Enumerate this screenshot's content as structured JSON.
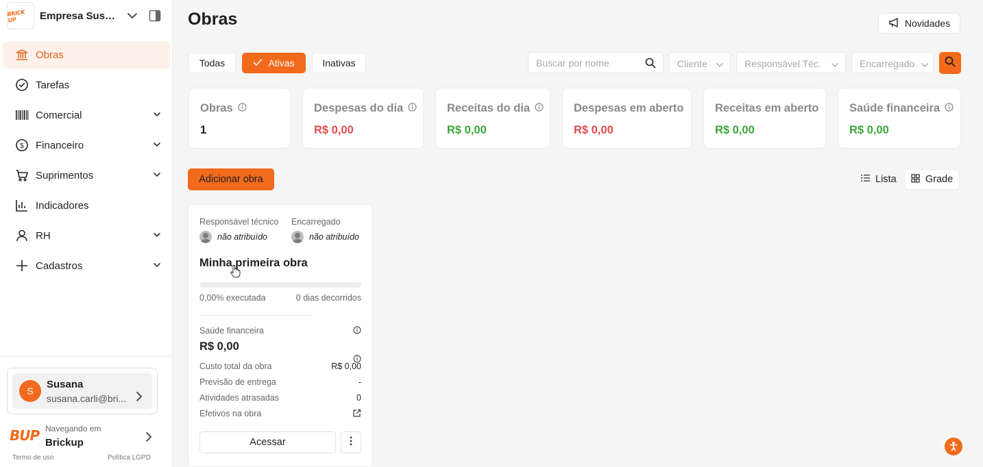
{
  "company": {
    "name": "Empresa Susan...",
    "logo_text": "BRICK UP"
  },
  "sidebar": {
    "items": [
      {
        "label": "Obras",
        "icon": "bank-icon",
        "active": true,
        "expandable": false
      },
      {
        "label": "Tarefas",
        "icon": "check-circle-icon",
        "active": false,
        "expandable": false
      },
      {
        "label": "Comercial",
        "icon": "barcode-icon",
        "active": false,
        "expandable": true
      },
      {
        "label": "Financeiro",
        "icon": "dollar-circle-icon",
        "active": false,
        "expandable": true
      },
      {
        "label": "Suprimentos",
        "icon": "cart-icon",
        "active": false,
        "expandable": true
      },
      {
        "label": "Indicadores",
        "icon": "bar-chart-icon",
        "active": false,
        "expandable": false
      },
      {
        "label": "RH",
        "icon": "user-icon",
        "active": false,
        "expandable": true
      },
      {
        "label": "Cadastros",
        "icon": "plus-icon",
        "active": false,
        "expandable": true
      }
    ]
  },
  "user": {
    "initial": "S",
    "name": "Susana",
    "email": "susana.carli@bri..."
  },
  "brand": {
    "navigating_label": "Navegando em",
    "name": "Brickup",
    "logo_text": "BUP"
  },
  "footer": {
    "terms": "Termo de uso",
    "privacy": "Política LGPD"
  },
  "header": {
    "title": "Obras",
    "news_label": "Novidades"
  },
  "filters": {
    "tabs": [
      {
        "label": "Todas",
        "active": false
      },
      {
        "label": "Ativas",
        "active": true
      },
      {
        "label": "Inativas",
        "active": false
      }
    ],
    "search_placeholder": "Buscar por nome",
    "client_placeholder": "Cliente",
    "responsible_placeholder": "Responsável Téc.",
    "foreman_placeholder": "Encarregado"
  },
  "stats": [
    {
      "label": "Obras",
      "value": "1",
      "info": true,
      "tone": "dark"
    },
    {
      "label": "Despesas do dia",
      "value": "R$ 0,00",
      "info": true,
      "tone": "red"
    },
    {
      "label": "Receitas do dia",
      "value": "R$ 0,00",
      "info": true,
      "tone": "green"
    },
    {
      "label": "Despesas em aberto",
      "value": "R$ 0,00",
      "info": false,
      "tone": "red"
    },
    {
      "label": "Receitas em aberto",
      "value": "R$ 0,00",
      "info": false,
      "tone": "green"
    },
    {
      "label": "Saúde financeira",
      "value": "R$ 0,00",
      "info": true,
      "tone": "green"
    }
  ],
  "actions": {
    "add_label": "Adicionar obra",
    "view_list": "Lista",
    "view_grid": "Grade",
    "active_view": "grid"
  },
  "obra_card": {
    "responsible_label": "Responsável técnico",
    "responsible_value": "não atribuído",
    "foreman_label": "Encarregado",
    "foreman_value": "não atribuído",
    "title": "Minha primeira obra",
    "progress_fraction": 0.0,
    "executed_text": "0,00% executada",
    "days_text": "0 dias decorridos",
    "health_label": "Saúde financeira",
    "health_value": "R$ 0,00",
    "rows": [
      {
        "label": "Custo total da obra",
        "value": "R$ 0,00"
      },
      {
        "label": "Previsão de entrega",
        "value": "-"
      },
      {
        "label": "Atividades atrasadas",
        "value": "0"
      },
      {
        "label": "Efetivos na obra",
        "value": ""
      }
    ],
    "access_label": "Acessar"
  },
  "colors": {
    "accent": "#f26a1b",
    "active_bg": "#fdf1ea",
    "red": "#e24a4a",
    "green": "#3aa63a"
  }
}
